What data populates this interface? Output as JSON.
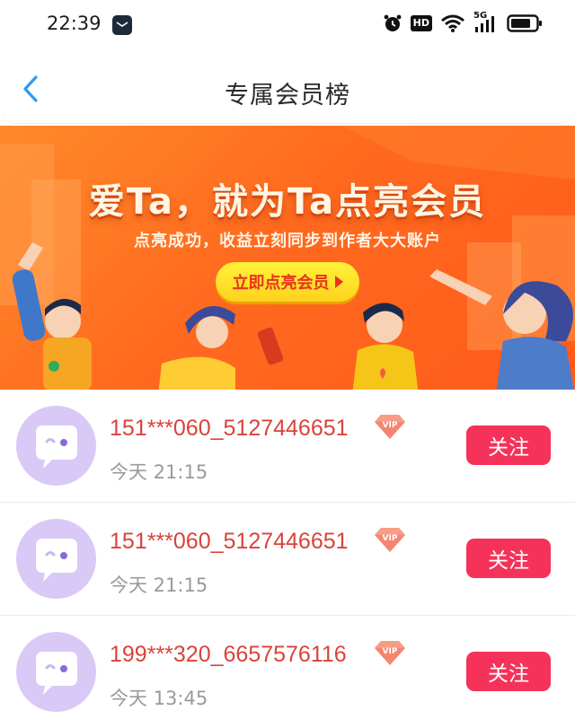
{
  "status_bar": {
    "time": "22:39",
    "icons": [
      "message-icon",
      "alarm-icon",
      "hd-icon",
      "wifi-icon",
      "5g-signal-icon",
      "battery-icon"
    ],
    "hd_label": "HD",
    "network_label": "5G"
  },
  "header": {
    "title": "专属会员榜",
    "back_icon": "chevron-left-icon"
  },
  "banner": {
    "title": "爱Ta，就为Ta点亮会员",
    "subtitle": "点亮成功，收益立刻同步到作者大大账户",
    "cta_label": "立即点亮会员"
  },
  "members": [
    {
      "name": "151***060_5127446651",
      "time": "今天 21:15",
      "badge": "VIP",
      "action": "关注"
    },
    {
      "name": "151***060_5127446651",
      "time": "今天 21:15",
      "badge": "VIP",
      "action": "关注"
    },
    {
      "name": "199***320_6657576116",
      "time": "今天 13:45",
      "badge": "VIP",
      "action": "关注"
    }
  ],
  "colors": {
    "accent": "#2e9bf0",
    "banner_orange": "#ff6a1f",
    "username_red": "#d9433a",
    "follow_button": "#f5325a",
    "avatar_bg": "#d9c9f7"
  }
}
